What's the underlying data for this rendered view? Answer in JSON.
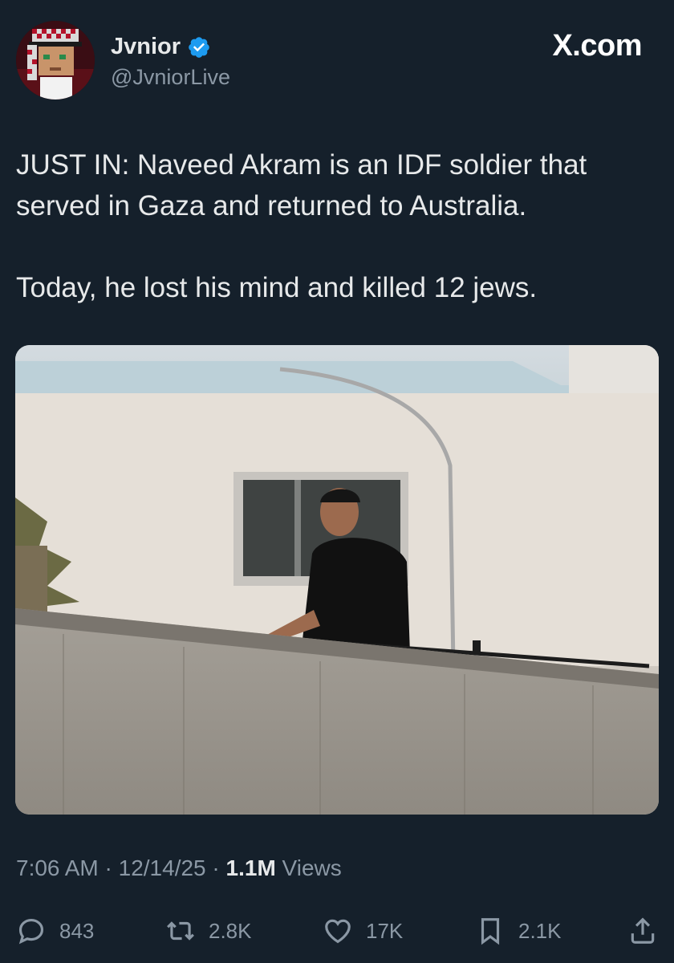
{
  "author": {
    "display_name": "Jvnior",
    "handle": "@JvniorLive",
    "verified": true,
    "avatar_icon": "pixel-art-avatar",
    "verified_icon": "verified-badge-icon"
  },
  "site_label": "X.com",
  "tweet": {
    "text": "JUST IN: Naveed Akram is an IDF soldier that served in Gaza and returned to Australia.\n\nToday, he lost his mind and killed 12 jews."
  },
  "media": {
    "type": "photo"
  },
  "meta": {
    "time": "7:06 AM",
    "date": "12/14/25",
    "views_count": "1.1M",
    "views_label": "Views",
    "separator": "·"
  },
  "actions": {
    "replies": "843",
    "reposts": "2.8K",
    "likes": "17K",
    "bookmarks": "2.1K"
  },
  "colors": {
    "background": "#15202b",
    "text": "#e7e9ea",
    "muted": "#8b98a5",
    "verified_blue": "#1d9bf0"
  }
}
